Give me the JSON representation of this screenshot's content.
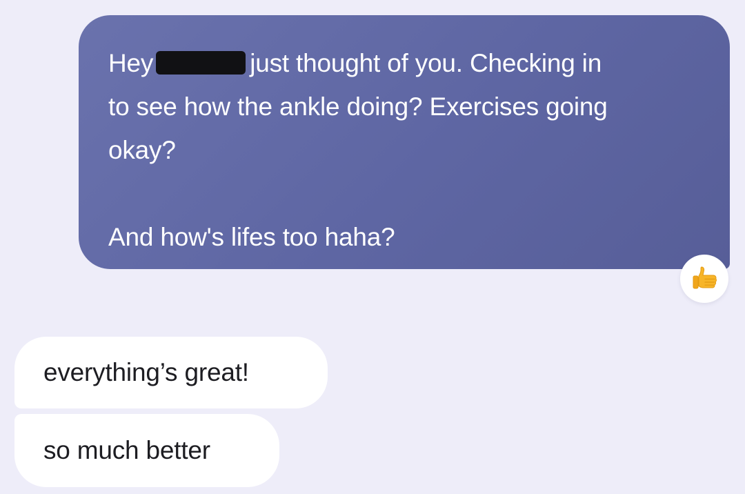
{
  "conversation": {
    "outgoing": {
      "greeting": "Hey",
      "line1_rest": "just thought of you. Checking in",
      "line2": "to see how the ankle doing? Exercises going",
      "line3": "okay?",
      "line4": "And how's lifes too haha?",
      "reaction_icon": "thumbs-up-emoji"
    },
    "incoming": [
      {
        "text": "everything’s great!"
      },
      {
        "text": "so much better"
      }
    ]
  },
  "colors": {
    "background": "#eeedf9",
    "outgoing_bubble": "#5e66a3",
    "incoming_bubble": "#ffffff",
    "reaction_thumb": "#f7b529"
  }
}
